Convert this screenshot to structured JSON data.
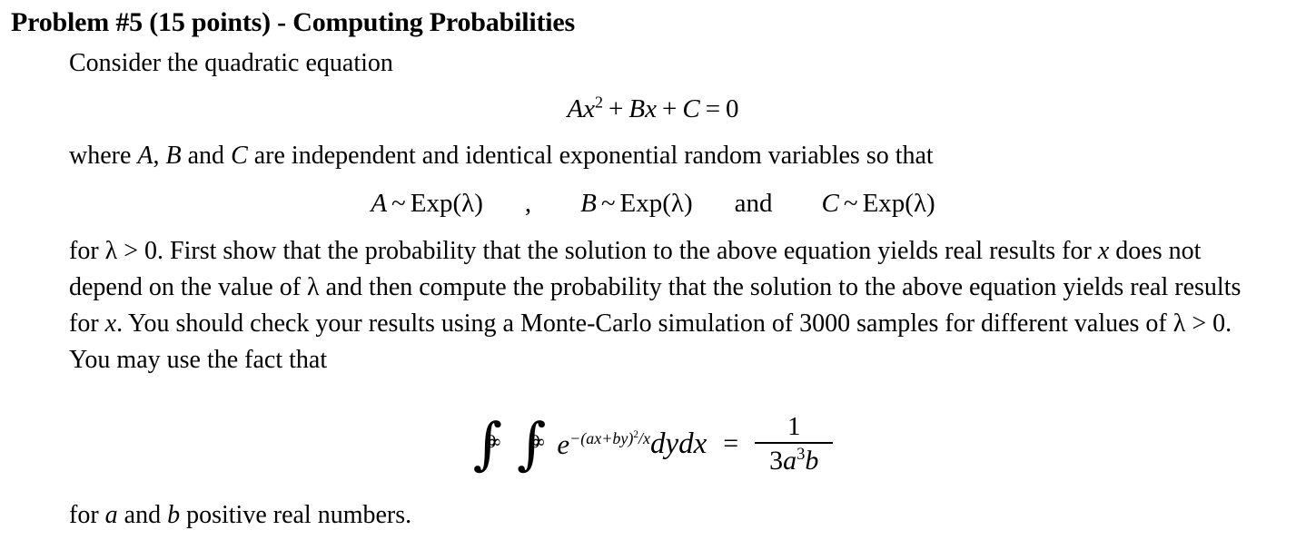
{
  "document": {
    "background_color": "#ffffff",
    "text_color": "#000000",
    "title": "Problem #5 (15 points) - Computing Probabilities",
    "intro_line": "Consider the quadratic equation",
    "equation_1": {
      "coef_a": "A",
      "var_x": "x",
      "exponent": "2",
      "plus_1": "+",
      "coef_b": "B",
      "var_x2": "x",
      "plus_2": "+",
      "coef_c": "C",
      "equals": "=",
      "rhs": "0"
    },
    "where_line": {
      "part_1": "where ",
      "var_a": "A",
      "comma": ", ",
      "var_b": "B",
      "part_2": " and ",
      "var_c": "C",
      "part_3": " are independent and identical exponential random variables so that"
    },
    "distributions": {
      "a_var": "A",
      "a_tilde": "~",
      "a_dist": "Exp(",
      "a_lambda": "λ",
      "a_close": ")",
      "separator_comma": ",",
      "b_var": "B",
      "b_tilde": "~",
      "b_dist": "Exp(",
      "b_lambda": "λ",
      "b_close": ")",
      "conjunction": "and",
      "c_var": "C",
      "c_tilde": "~",
      "c_dist": "Exp(",
      "c_lambda": "λ",
      "c_close": ")"
    },
    "body_paragraph": {
      "seg_1": "for ",
      "lambda_1": "λ",
      "seg_2": " > 0. First show that the probability that the solution to the above equation yields real results for ",
      "x_1": "x",
      "seg_3": " does not depend on the value of ",
      "lambda_2": "λ",
      "seg_4": " and then compute the probability that the solution to the above equation yields real results for ",
      "x_2": "x",
      "seg_5": ". You should check your results using a Monte-Carlo simulation of ",
      "samples": "3000",
      "seg_6": " samples for different values of ",
      "lambda_3": "λ",
      "seg_7": " > 0. You may use the fact that"
    },
    "integral_formula": {
      "integral_symbol": "∫",
      "upper_limit": "∞",
      "lower_limit": "0",
      "base": "e",
      "exponent_text": "−(ax+by)",
      "exponent_power": "2",
      "exponent_div": "/x",
      "differentials": "dydx",
      "equals": "=",
      "fraction_numerator": "1",
      "fraction_denominator_3": "3",
      "fraction_denominator_a": "a",
      "fraction_denominator_pow": "3",
      "fraction_denominator_b": "b"
    },
    "closing_line": {
      "seg_1": "for ",
      "var_a": "a",
      "seg_2": " and ",
      "var_b": "b",
      "seg_3": " positive real numbers."
    }
  }
}
